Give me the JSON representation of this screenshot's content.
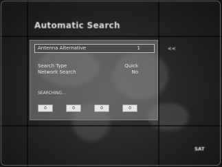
{
  "window": {
    "title": "Automatic Search"
  },
  "dialog": {
    "selected_row": {
      "label": "Antenna Alternative",
      "value": "1"
    },
    "rows": [
      {
        "label": "Search Type",
        "value": "Quick"
      },
      {
        "label": "Network Search",
        "value": "No"
      }
    ],
    "status_text": "SEARCHING...",
    "buttons": [
      {
        "label": "0"
      },
      {
        "label": "0"
      },
      {
        "label": "0"
      },
      {
        "label": "0"
      }
    ]
  },
  "side": {
    "indicator": "<<"
  },
  "logo_text": "SAT",
  "colors": {
    "background": "#262626",
    "panel": "#969696",
    "highlight": "#4a4a4a",
    "text": "#e6e6e6"
  }
}
